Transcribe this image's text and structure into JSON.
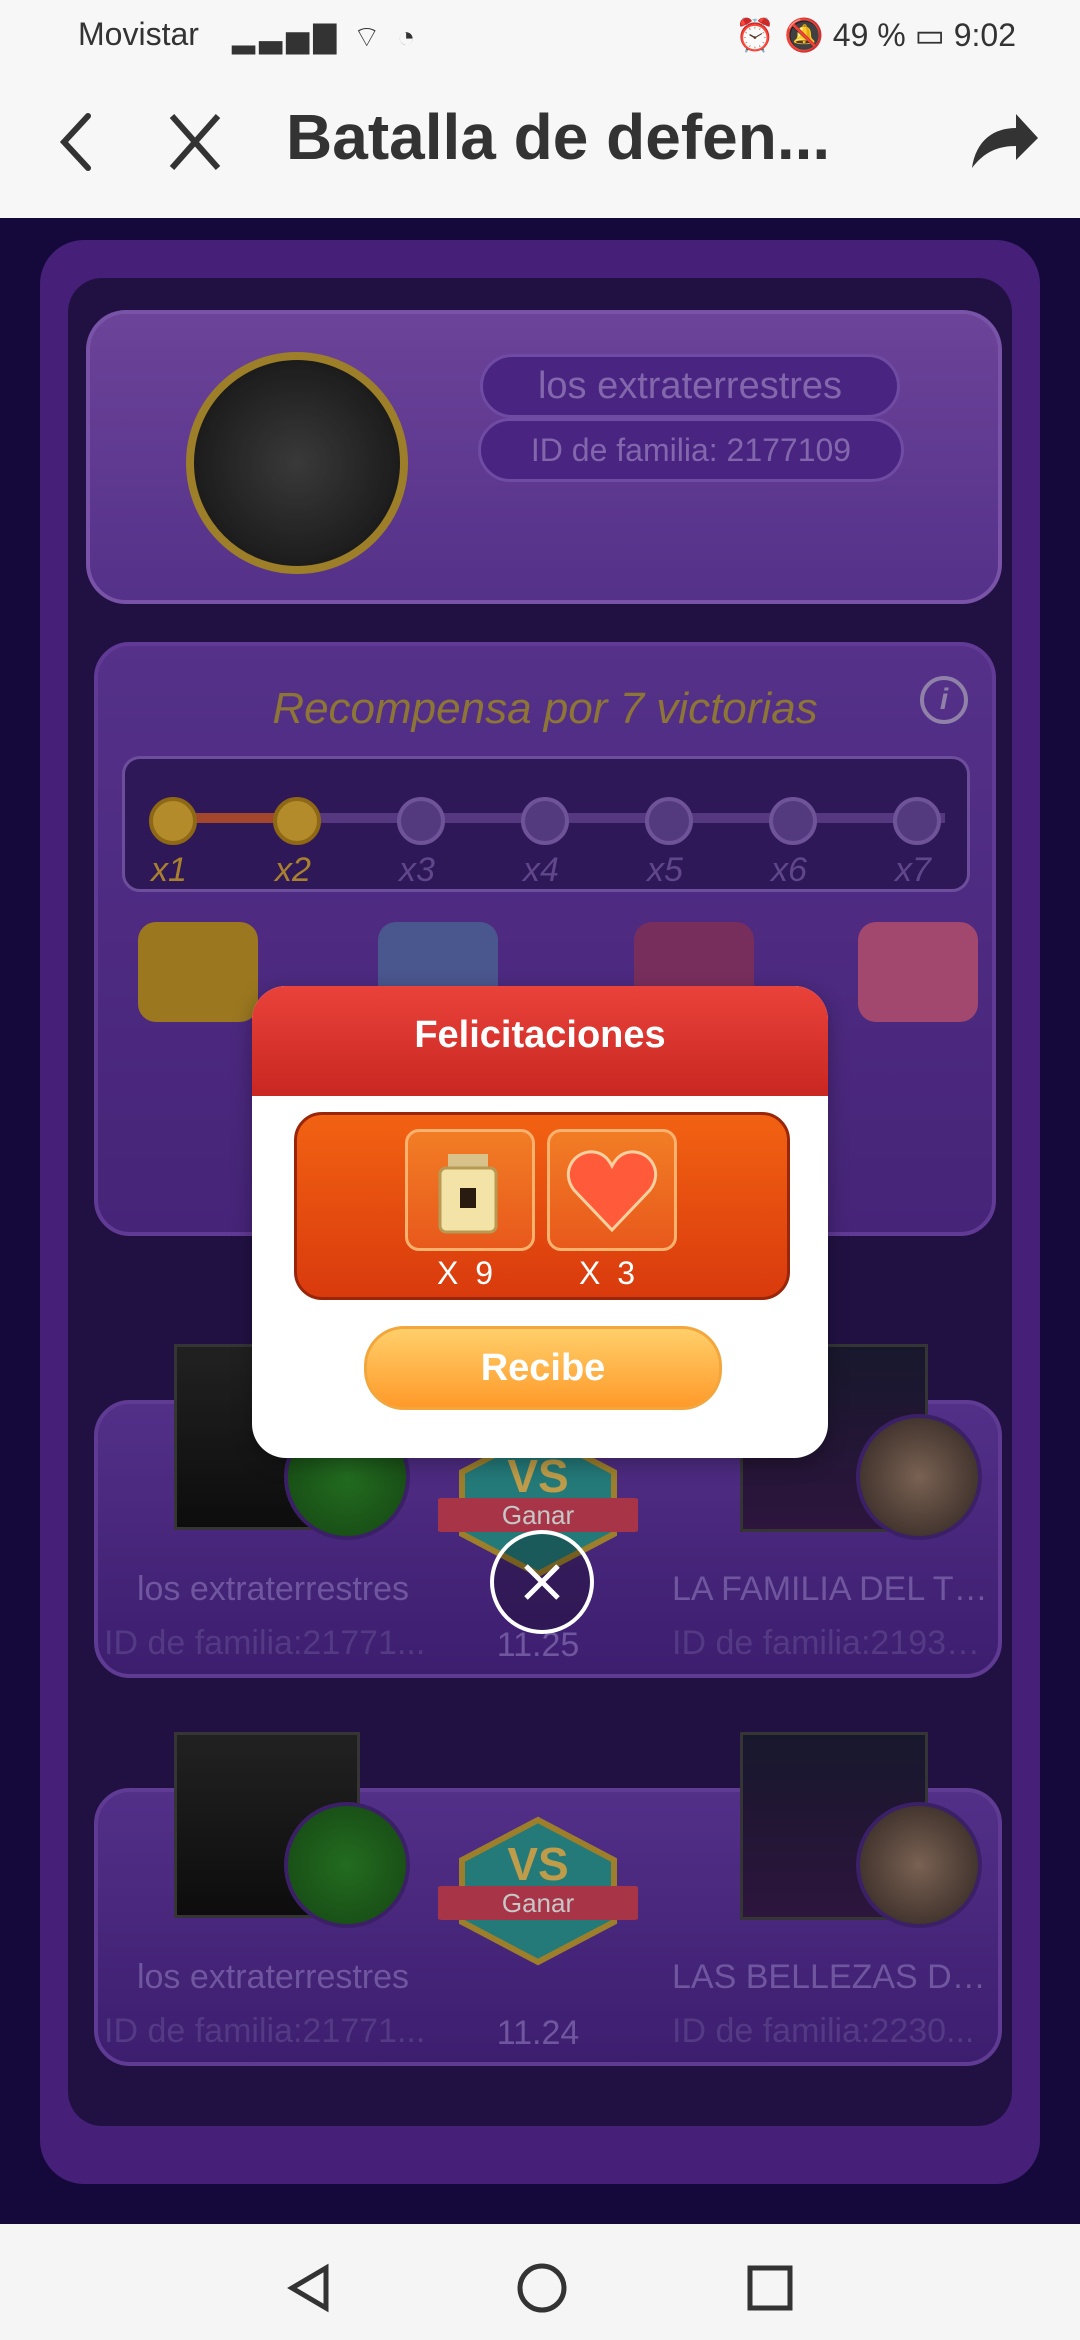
{
  "status_bar": {
    "carrier": "Movistar",
    "right": "⏰ 🔕 49 % ▭ 9:02"
  },
  "app_bar": {
    "title": "Batalla de defen...",
    "icons": [
      "back-arrow-icon",
      "close-icon",
      "share-icon"
    ]
  },
  "family": {
    "name": "los extraterrestres",
    "id": "ID de familia: 2177109"
  },
  "reward": {
    "title": "Recompensa por 7 victorias",
    "steps": [
      "x1",
      "x2",
      "x3",
      "x4",
      "x5",
      "x6",
      "x7"
    ],
    "completed": 2
  },
  "battles": [
    {
      "left_name": "los extraterrestres",
      "left_id": "ID de familia:21771...",
      "right_name": "LA FAMILIA DEL TI...",
      "right_id": "ID de familia:21936...",
      "vs": "VS",
      "result": "Ganar",
      "date": "11.25"
    },
    {
      "left_name": "los extraterrestres",
      "left_id": "ID de familia:21771...",
      "right_name": "LAS BELLEZAS DE...",
      "right_id": "ID de familia:2230...",
      "vs": "VS",
      "result": "Ganar",
      "date": "11.24"
    }
  ],
  "modal": {
    "title": "Felicitaciones",
    "items": [
      {
        "icon": "perfume-icon",
        "qty": "X 9"
      },
      {
        "icon": "heart-gem-icon",
        "qty": "X 3"
      }
    ],
    "button": "Recibe"
  }
}
